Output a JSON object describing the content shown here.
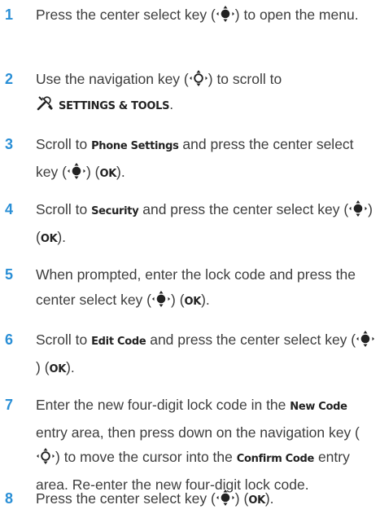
{
  "steps": [
    {
      "number": "1",
      "parts": [
        "Press the center select key (",
        ") to open the menu."
      ]
    },
    {
      "number": "2",
      "parts": [
        "Use the navigation key (",
        ") to scroll to",
        "SETTINGS & TOOLS",
        "."
      ]
    },
    {
      "number": "3",
      "parts": [
        "Scroll to ",
        "Phone Settings",
        " and press the center select key (",
        ") (",
        "OK",
        ")."
      ]
    },
    {
      "number": "4",
      "parts": [
        "Scroll to ",
        "Security",
        " and press the center select key (",
        ") (",
        "OK",
        ")."
      ]
    },
    {
      "number": "5",
      "parts": [
        "When prompted, enter the lock code and press the center select key (",
        ") (",
        "OK",
        ")."
      ]
    },
    {
      "number": "6",
      "parts": [
        "Scroll to ",
        "Edit Code",
        " and press the center select key (",
        ") (",
        "OK",
        ")."
      ]
    },
    {
      "number": "7",
      "parts": [
        "Enter the new four-digit lock code in the ",
        "New Code",
        " entry area, then press down on the navigation key (",
        ") to move the cursor into the ",
        "Confirm Code",
        " entry area. Re-enter the new four-digit lock code."
      ]
    },
    {
      "number": "8",
      "parts": [
        "Press the center select key (",
        ") (",
        "OK",
        ")."
      ]
    }
  ],
  "icons": {
    "center_select_key": "center-select-key-icon",
    "navigation_key": "navigation-key-icon",
    "settings_tools": "settings-tools-icon"
  },
  "colors": {
    "step_number": "#2a8fd6",
    "body_text": "#3d3d3d"
  }
}
